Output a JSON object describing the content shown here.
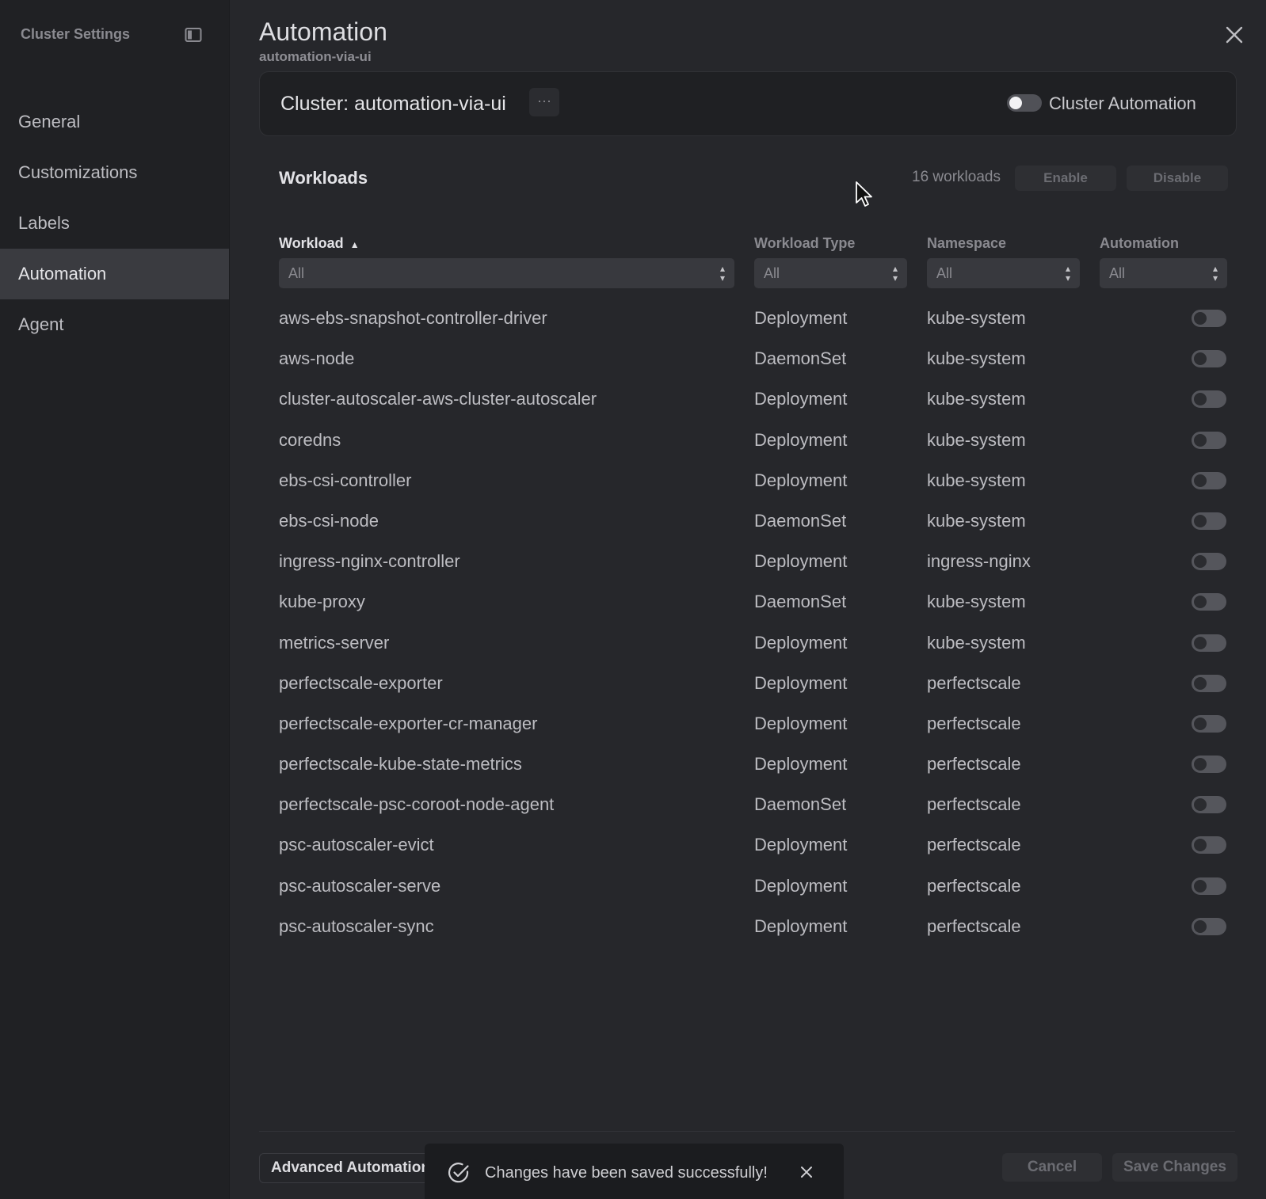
{
  "sidebar": {
    "title": "Cluster Settings",
    "items": [
      {
        "label": "General",
        "active": false
      },
      {
        "label": "Customizations",
        "active": false
      },
      {
        "label": "Labels",
        "active": false
      },
      {
        "label": "Automation",
        "active": true
      },
      {
        "label": "Agent",
        "active": false
      }
    ]
  },
  "header": {
    "title": "Automation",
    "subtitle": "automation-via-ui"
  },
  "cluster_card": {
    "name": "Cluster: automation-via-ui",
    "more_label": "···",
    "toggle_label": "Cluster Automation",
    "toggle_on": false
  },
  "workloads": {
    "title": "Workloads",
    "count_label": "16 workloads",
    "enable_label": "Enable",
    "disable_label": "Disable",
    "columns": {
      "workload": "Workload",
      "workload_type": "Workload Type",
      "namespace": "Namespace",
      "automation": "Automation"
    },
    "filters": {
      "workload": "All",
      "workload_type": "All",
      "namespace": "All",
      "automation": "All"
    },
    "rows": [
      {
        "name": "aws-ebs-snapshot-controller-driver",
        "type": "Deployment",
        "namespace": "kube-system",
        "automation": false
      },
      {
        "name": "aws-node",
        "type": "DaemonSet",
        "namespace": "kube-system",
        "automation": false
      },
      {
        "name": "cluster-autoscaler-aws-cluster-autoscaler",
        "type": "Deployment",
        "namespace": "kube-system",
        "automation": false
      },
      {
        "name": "coredns",
        "type": "Deployment",
        "namespace": "kube-system",
        "automation": false
      },
      {
        "name": "ebs-csi-controller",
        "type": "Deployment",
        "namespace": "kube-system",
        "automation": false
      },
      {
        "name": "ebs-csi-node",
        "type": "DaemonSet",
        "namespace": "kube-system",
        "automation": false
      },
      {
        "name": "ingress-nginx-controller",
        "type": "Deployment",
        "namespace": "ingress-nginx",
        "automation": false
      },
      {
        "name": "kube-proxy",
        "type": "DaemonSet",
        "namespace": "kube-system",
        "automation": false
      },
      {
        "name": "metrics-server",
        "type": "Deployment",
        "namespace": "kube-system",
        "automation": false
      },
      {
        "name": "perfectscale-exporter",
        "type": "Deployment",
        "namespace": "perfectscale",
        "automation": false
      },
      {
        "name": "perfectscale-exporter-cr-manager",
        "type": "Deployment",
        "namespace": "perfectscale",
        "automation": false
      },
      {
        "name": "perfectscale-kube-state-metrics",
        "type": "Deployment",
        "namespace": "perfectscale",
        "automation": false
      },
      {
        "name": "perfectscale-psc-coroot-node-agent",
        "type": "DaemonSet",
        "namespace": "perfectscale",
        "automation": false
      },
      {
        "name": "psc-autoscaler-evict",
        "type": "Deployment",
        "namespace": "perfectscale",
        "automation": false
      },
      {
        "name": "psc-autoscaler-serve",
        "type": "Deployment",
        "namespace": "perfectscale",
        "automation": false
      },
      {
        "name": "psc-autoscaler-sync",
        "type": "Deployment",
        "namespace": "perfectscale",
        "automation": false
      }
    ]
  },
  "footer": {
    "advanced_label": "Advanced Automation",
    "cancel_label": "Cancel",
    "save_label": "Save Changes"
  },
  "toast": {
    "message": "Changes have been saved successfully!"
  }
}
